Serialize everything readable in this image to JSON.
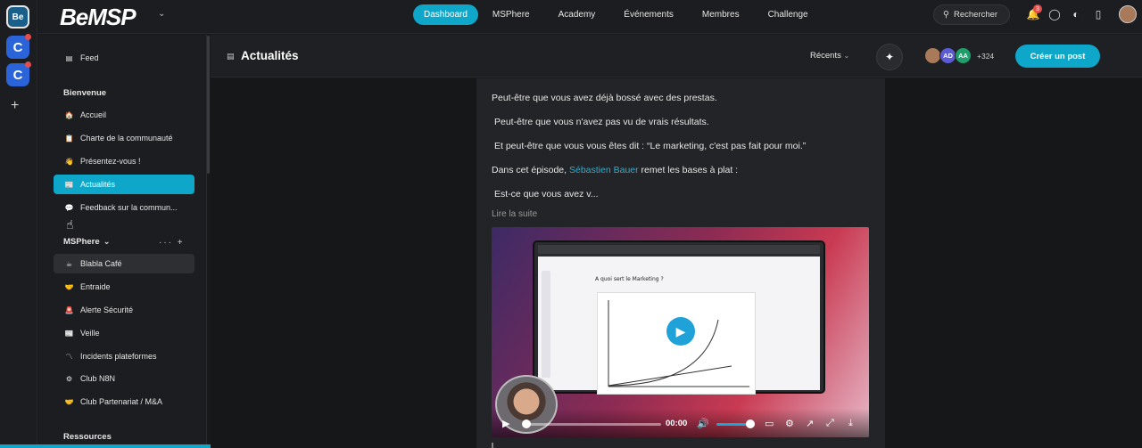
{
  "rail": {
    "workspace_main": "Be",
    "workspace_c1": "C",
    "workspace_c2": "C",
    "add": "+"
  },
  "header": {
    "logo": "BeMSP",
    "nav": [
      "Dashboard",
      "MSPhere",
      "Academy",
      "Événements",
      "Membres",
      "Challenge"
    ],
    "active_nav": "Dashboard",
    "search_label": "Rechercher",
    "notification_count": "3"
  },
  "sidebar": {
    "feed": "Feed",
    "sections": {
      "bienvenue": "Bienvenue",
      "msphere": "MSPhere",
      "ressources": "Ressources"
    },
    "bienvenue_items": [
      {
        "label": "Accueil",
        "icon": "🏠"
      },
      {
        "label": "Charte de la communauté",
        "icon": "📋"
      },
      {
        "label": "Présentez-vous !",
        "icon": "👋"
      },
      {
        "label": "Actualités",
        "icon": "📰"
      },
      {
        "label": "Feedback sur la commun...",
        "icon": "💬"
      }
    ],
    "msphere_items": [
      {
        "label": "Blabla Café",
        "icon": "☕"
      },
      {
        "label": "Entraide",
        "icon": "🤝"
      },
      {
        "label": "Alerte Sécurité",
        "icon": "🚨"
      },
      {
        "label": "Veille",
        "icon": "📰"
      },
      {
        "label": "Incidents plateformes",
        "icon": "〽"
      },
      {
        "label": "Club N8N",
        "icon": "⚙"
      },
      {
        "label": "Club Partenariat / M&A",
        "icon": "🤝"
      }
    ],
    "section_tools": "··· +"
  },
  "main": {
    "title": "Actualités",
    "sort_label": "Récents",
    "avatars": [
      {
        "initials": "",
        "color": "#a87a5a"
      },
      {
        "initials": "AD",
        "color": "#5b5bd6"
      },
      {
        "initials": "AA",
        "color": "#1f9d6b"
      }
    ],
    "member_count": "+324",
    "create_post": "Créer un post"
  },
  "post": {
    "line1": "Peut-être que vous avez déjà bossé avec des prestas.",
    "line2": "Peut-être que vous n'avez pas vu de vrais résultats.",
    "line3": "Et peut-être que vous vous êtes dit : “Le marketing, c'est pas fait pour moi.”",
    "line4_prefix": "Dans cet épisode,",
    "line4_link": "Sébastien Bauer",
    "line4_suffix": "remet les bases à plat :",
    "line5": "Est-ce que vous avez v...",
    "read_more": "Lire la suite"
  },
  "video": {
    "slide_heading": "A quoi sert le Marketing ?",
    "time": "00:00",
    "progress": 0.02,
    "volume": 0.9
  }
}
